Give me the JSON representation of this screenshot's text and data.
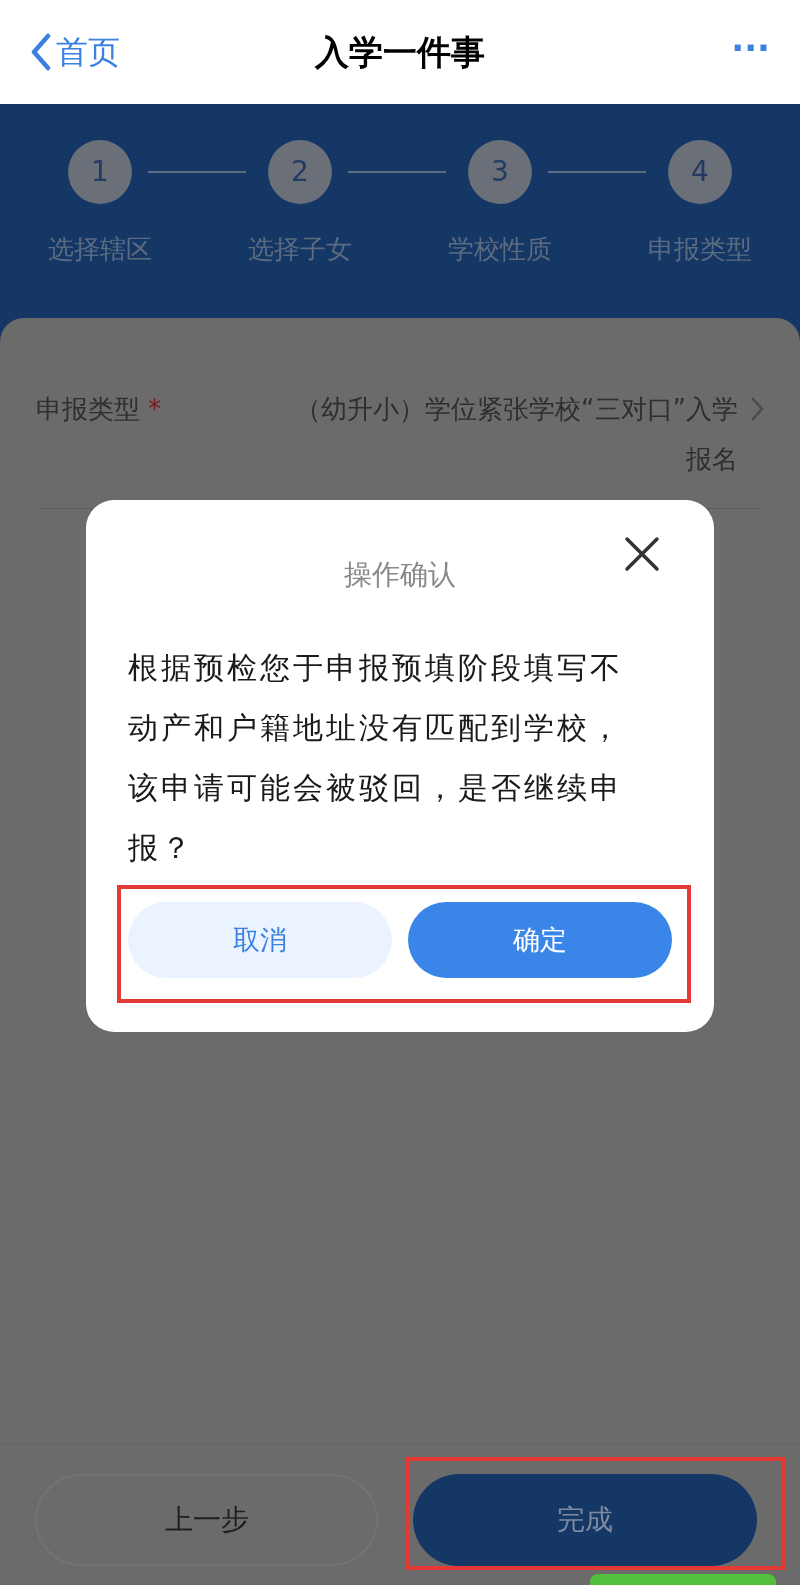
{
  "nav": {
    "back": "首页",
    "title": "入学一件事",
    "more": "···"
  },
  "steps": [
    {
      "number": "1",
      "label": "选择辖区"
    },
    {
      "number": "2",
      "label": "选择子女"
    },
    {
      "number": "3",
      "label": "学校性质"
    },
    {
      "number": "4",
      "label": "申报类型"
    }
  ],
  "form": {
    "label": "申报类型",
    "required_mark": "*",
    "value": "（幼升小）学位紧张学校“三对口”入学报名"
  },
  "dialog": {
    "title": "操作确认",
    "message": "根据预检您于申报预填阶段填写不动产和户籍地址没有匹配到学校，该申请可能会被驳回，是否继续申报？",
    "buttons": [
      {
        "label": "取消",
        "kind": "secondary"
      },
      {
        "label": "确定",
        "kind": "primary"
      }
    ]
  },
  "footer": {
    "buttons": [
      {
        "label": "上一步",
        "kind": "secondary"
      },
      {
        "label": "完成",
        "kind": "primary"
      }
    ]
  }
}
